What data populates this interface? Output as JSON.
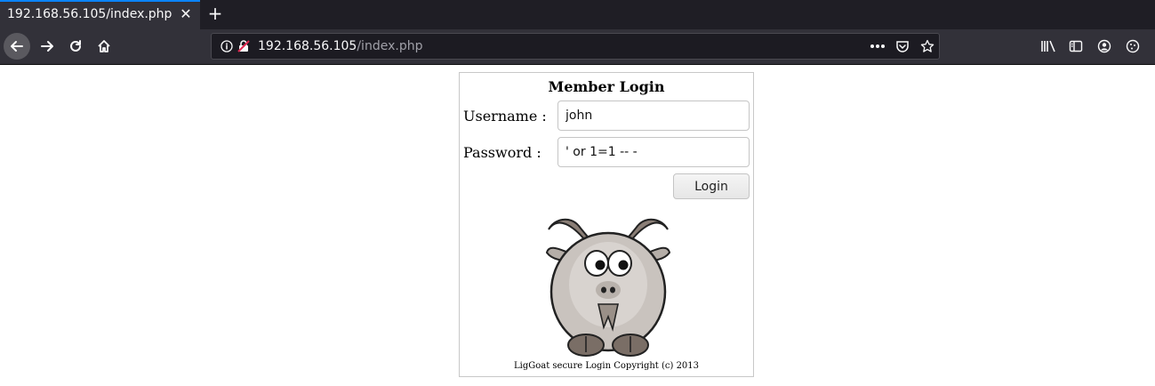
{
  "browser": {
    "tab_title": "192.168.56.105/index.php",
    "tab_close": "✕",
    "new_tab": "+",
    "url_host": "192.168.56.105",
    "url_path": "/index.php"
  },
  "login": {
    "title": "Member Login",
    "username_label": "Username :",
    "username_value": "john",
    "password_label": "Password :",
    "password_value": "' or 1=1 -- -",
    "button_label": "Login",
    "footer": "LigGoat secure Login Copyright (c) 2013"
  },
  "colors": {
    "tab_accent": "#0a84ff",
    "toolbar_bg": "#323139",
    "goat_body": "#c9c3be",
    "goat_horn": "#8a7e76"
  },
  "icons": [
    "back-icon",
    "forward-icon",
    "reload-icon",
    "home-icon",
    "info-icon",
    "insecure-lock-icon",
    "more-icon",
    "pocket-icon",
    "star-icon",
    "library-icon",
    "sidebar-icon",
    "account-icon",
    "extension-icon"
  ]
}
